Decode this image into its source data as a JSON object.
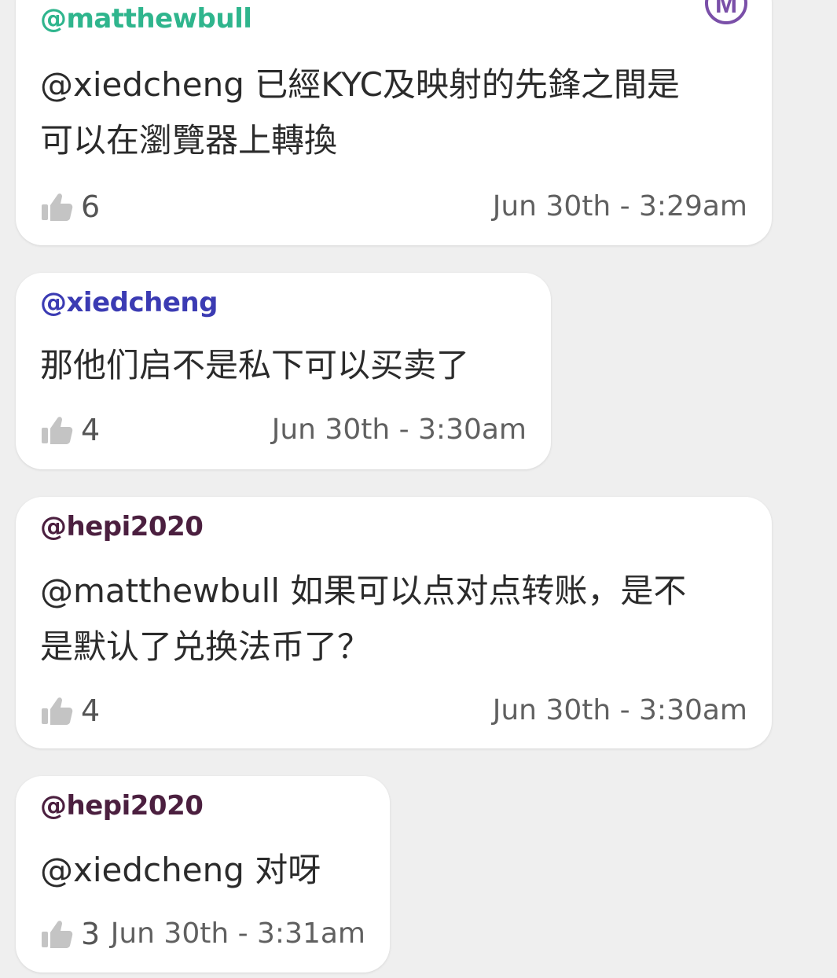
{
  "comments": [
    {
      "username": "@matthewbull",
      "username_color": "#2fb58d",
      "lines": [
        "@xiedcheng 已經KYC及映射的先鋒之間是",
        "可以在瀏覽器上轉換"
      ],
      "likes": "6",
      "timestamp": "Jun 30th - 3:29am",
      "badge": {
        "letter": "M",
        "icon": "member-badge-icon",
        "color": "#7a4fa8"
      }
    },
    {
      "username": "@xiedcheng",
      "username_color": "#3b3bb3",
      "lines": [
        "那他们启不是私下可以买卖了"
      ],
      "likes": "4",
      "timestamp": "Jun 30th - 3:30am"
    },
    {
      "username": "@hepi2020",
      "username_color": "#4b1f3f",
      "lines": [
        "@matthewbull 如果可以点对点转账，是不",
        "是默认了兑换法币了？"
      ],
      "likes": "4",
      "timestamp": "Jun 30th - 3:30am"
    },
    {
      "username": "@hepi2020",
      "username_color": "#4b1f3f",
      "lines": [
        "@xiedcheng 对呀"
      ],
      "likes": "3",
      "timestamp": "Jun 30th - 3:31am"
    }
  ],
  "icons": {
    "like": "thumbs-up-icon"
  }
}
